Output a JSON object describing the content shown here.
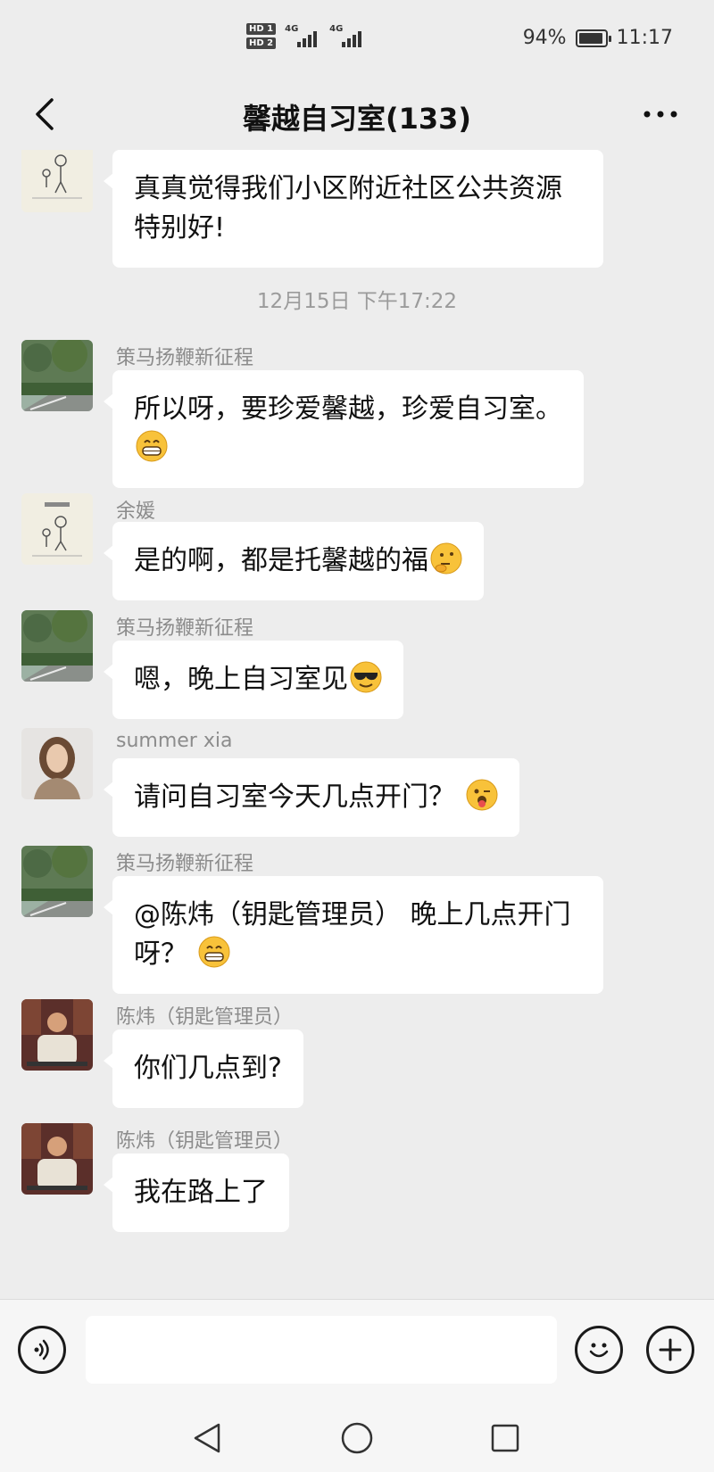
{
  "status_bar": {
    "hd1": "HD 1",
    "hd2": "HD 2",
    "net1": "4G",
    "net2": "4G",
    "battery_percent": "94%",
    "battery_level": 0.94,
    "time": "11:17"
  },
  "header": {
    "title": "馨越自习室(133)",
    "back_icon": "chevron-left-icon",
    "more_icon": "ellipsis-icon"
  },
  "messages": [
    {
      "sender": "",
      "text": "真真觉得我们小区附近社区公共资源特别好!",
      "emoji": ""
    },
    {
      "sender": "策马扬鞭新征程",
      "text": "所以呀，要珍爱馨越，珍爱自习室。",
      "emoji": "grinning-face"
    },
    {
      "sender": "余媛",
      "text": "是的啊，都是托馨越的福",
      "emoji": "thinking-face"
    },
    {
      "sender": "策马扬鞭新征程",
      "text": "嗯，晚上自习室见",
      "emoji": "sunglasses-face"
    },
    {
      "sender": "summer xia",
      "text": "请问自习室今天几点开门？",
      "emoji": "winking-tongue-face"
    },
    {
      "sender": "策马扬鞭新征程",
      "text": "@陈炜（钥匙管理员） 晚上几点开门呀？",
      "emoji": "grinning-face"
    },
    {
      "sender": "陈炜（钥匙管理员）",
      "text": "你们几点到?",
      "emoji": ""
    },
    {
      "sender": "陈炜（钥匙管理员）",
      "text": "我在路上了",
      "emoji": ""
    }
  ],
  "timestamp": "12月15日 下午17:22",
  "input_bar": {
    "voice_icon": "voice-icon",
    "input_value": "",
    "emoji_icon": "emoji-icon",
    "add_icon": "plus-icon"
  },
  "nav_bar": {
    "back_icon": "triangle-back-icon",
    "home_icon": "circle-home-icon",
    "recent_icon": "square-recent-icon"
  },
  "colors": {
    "background": "#ededed",
    "bubble": "#ffffff",
    "sender_text": "#8c8c8c",
    "emoji_yellow": "#f8c23a"
  }
}
